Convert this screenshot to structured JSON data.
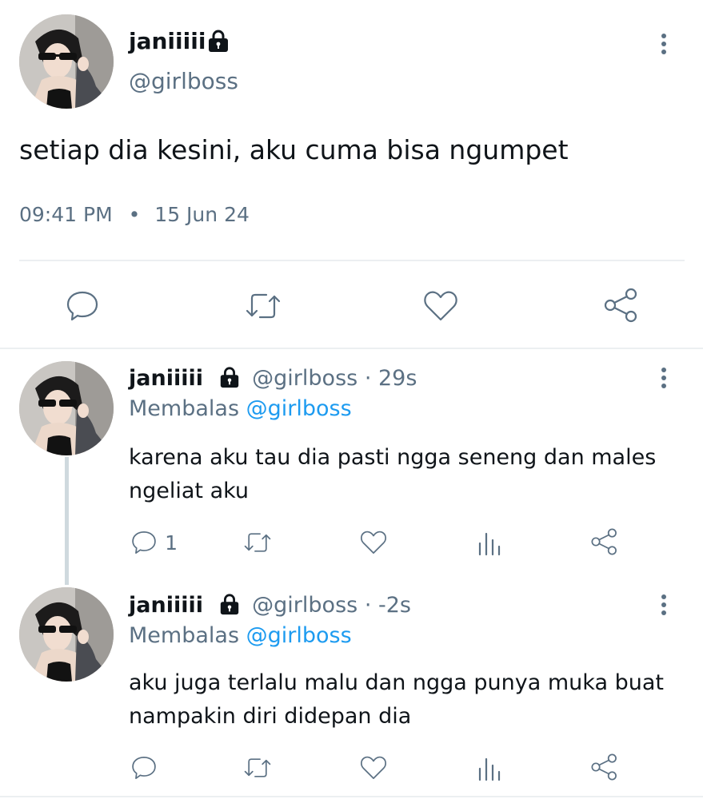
{
  "main_tweet": {
    "display_name": "janiiiii",
    "handle": "@girlboss",
    "text": "setiap dia kesini, aku cuma bisa ngumpet",
    "time": "09:41 PM",
    "separator": "•",
    "date": "15 Jun 24",
    "icons": [
      "comment-icon",
      "retweet-icon",
      "heart-icon",
      "share-icon",
      "lock-icon",
      "more-icon"
    ]
  },
  "replies": [
    {
      "display_name": "janiiiii",
      "handle": "@girlboss",
      "time": "· 29s",
      "replying_label": "Membalas",
      "replying_to": "@girlboss",
      "text_line1": "karena aku tau dia pasti ngga seneng dan males",
      "text_line2": "ngeliat aku",
      "reply_count": "1"
    },
    {
      "display_name": "janiiiii",
      "handle": "@girlboss",
      "time": "· -2s",
      "replying_label": "Membalas",
      "replying_to": "@girlboss",
      "text_line1": "aku juga terlalu malu dan ngga punya muka buat",
      "text_line2": "nampakin diri didepan dia",
      "reply_count": ""
    }
  ],
  "colors": {
    "text": "#0f1419",
    "secondary": "#5b7083",
    "link": "#1d9bf0",
    "divider": "#eceff1",
    "thread_line": "#cfd9de"
  }
}
